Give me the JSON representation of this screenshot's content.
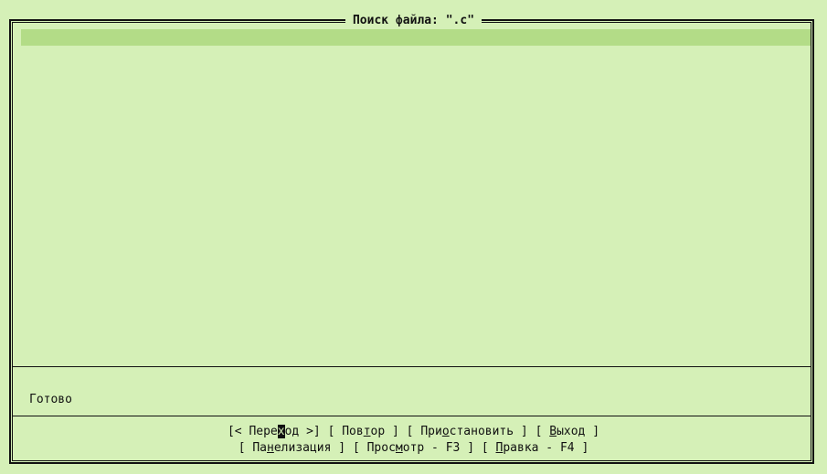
{
  "dialog": {
    "title": "Поиск файла: \".c\"",
    "status": "Готово"
  },
  "results": [],
  "buttons_row1": [
    {
      "name": "goto-button",
      "open": "[< ",
      "pre": "Пере",
      "hot": "х",
      "post": "од",
      "close": " >]",
      "focused": true
    },
    {
      "name": "repeat-button",
      "open": "[ ",
      "pre": "Пов",
      "hot": "т",
      "post": "ор",
      "close": " ]",
      "focused": false
    },
    {
      "name": "pause-button",
      "open": "[ ",
      "pre": "При",
      "hot": "о",
      "post": "становить",
      "close": " ]",
      "focused": false
    },
    {
      "name": "quit-button",
      "open": "[ ",
      "pre": "",
      "hot": "В",
      "post": "ыход",
      "close": " ]",
      "focused": false
    }
  ],
  "buttons_row2": [
    {
      "name": "panelize-button",
      "open": "[ ",
      "pre": "Па",
      "hot": "н",
      "post": "елизация",
      "close": " ]",
      "focused": false
    },
    {
      "name": "view-button",
      "open": "[ ",
      "pre": "Прос",
      "hot": "м",
      "post": "отр - F3",
      "close": " ]",
      "focused": false
    },
    {
      "name": "edit-button",
      "open": "[ ",
      "pre": "",
      "hot": "П",
      "post": "равка - F4",
      "close": " ]",
      "focused": false
    }
  ],
  "colors": {
    "background": "#d5f0b7",
    "selection": "#b3dc87",
    "frame": "#111111"
  }
}
